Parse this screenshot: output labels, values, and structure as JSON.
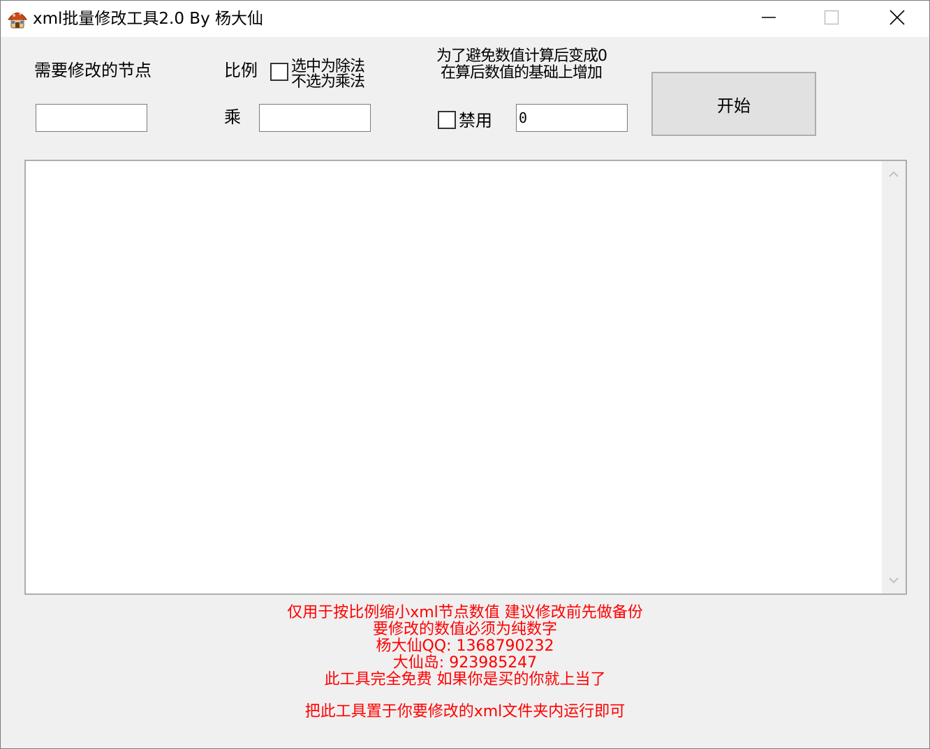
{
  "window": {
    "title": "xml批量修改工具2.0 By 杨大仙"
  },
  "form": {
    "node_label": "需要修改的节点",
    "node_value": "",
    "ratio_label": "比例",
    "divide_checkbox_line1": "选中为除法",
    "divide_checkbox_line2": "不选为乘法",
    "multiply_label": "乘",
    "ratio_value": "",
    "avoid_zero_line1": "为了避免数值计算后变成0",
    "avoid_zero_line2": "在算后数值的基础上增加",
    "disable_label": "禁用",
    "add_value": "0",
    "start_label": "开始"
  },
  "notes": {
    "line1": "仅用于按比例缩小xml节点数值  建议修改前先做备份",
    "line2": "要修改的数值必须为纯数字",
    "line3": "杨大仙QQ: 1368790232",
    "line4": "大仙岛: 923985247",
    "line5": "此工具完全免费 如果你是买的你就上当了",
    "line6": "把此工具置于你要修改的xml文件夹内运行即可"
  },
  "icons": {
    "app": "mushroom-house-icon",
    "minimize": "minimize-icon",
    "maximize": "maximize-icon",
    "close": "close-icon"
  },
  "colors": {
    "note_text": "#ff0000",
    "window_bg": "#f0f0f0"
  }
}
